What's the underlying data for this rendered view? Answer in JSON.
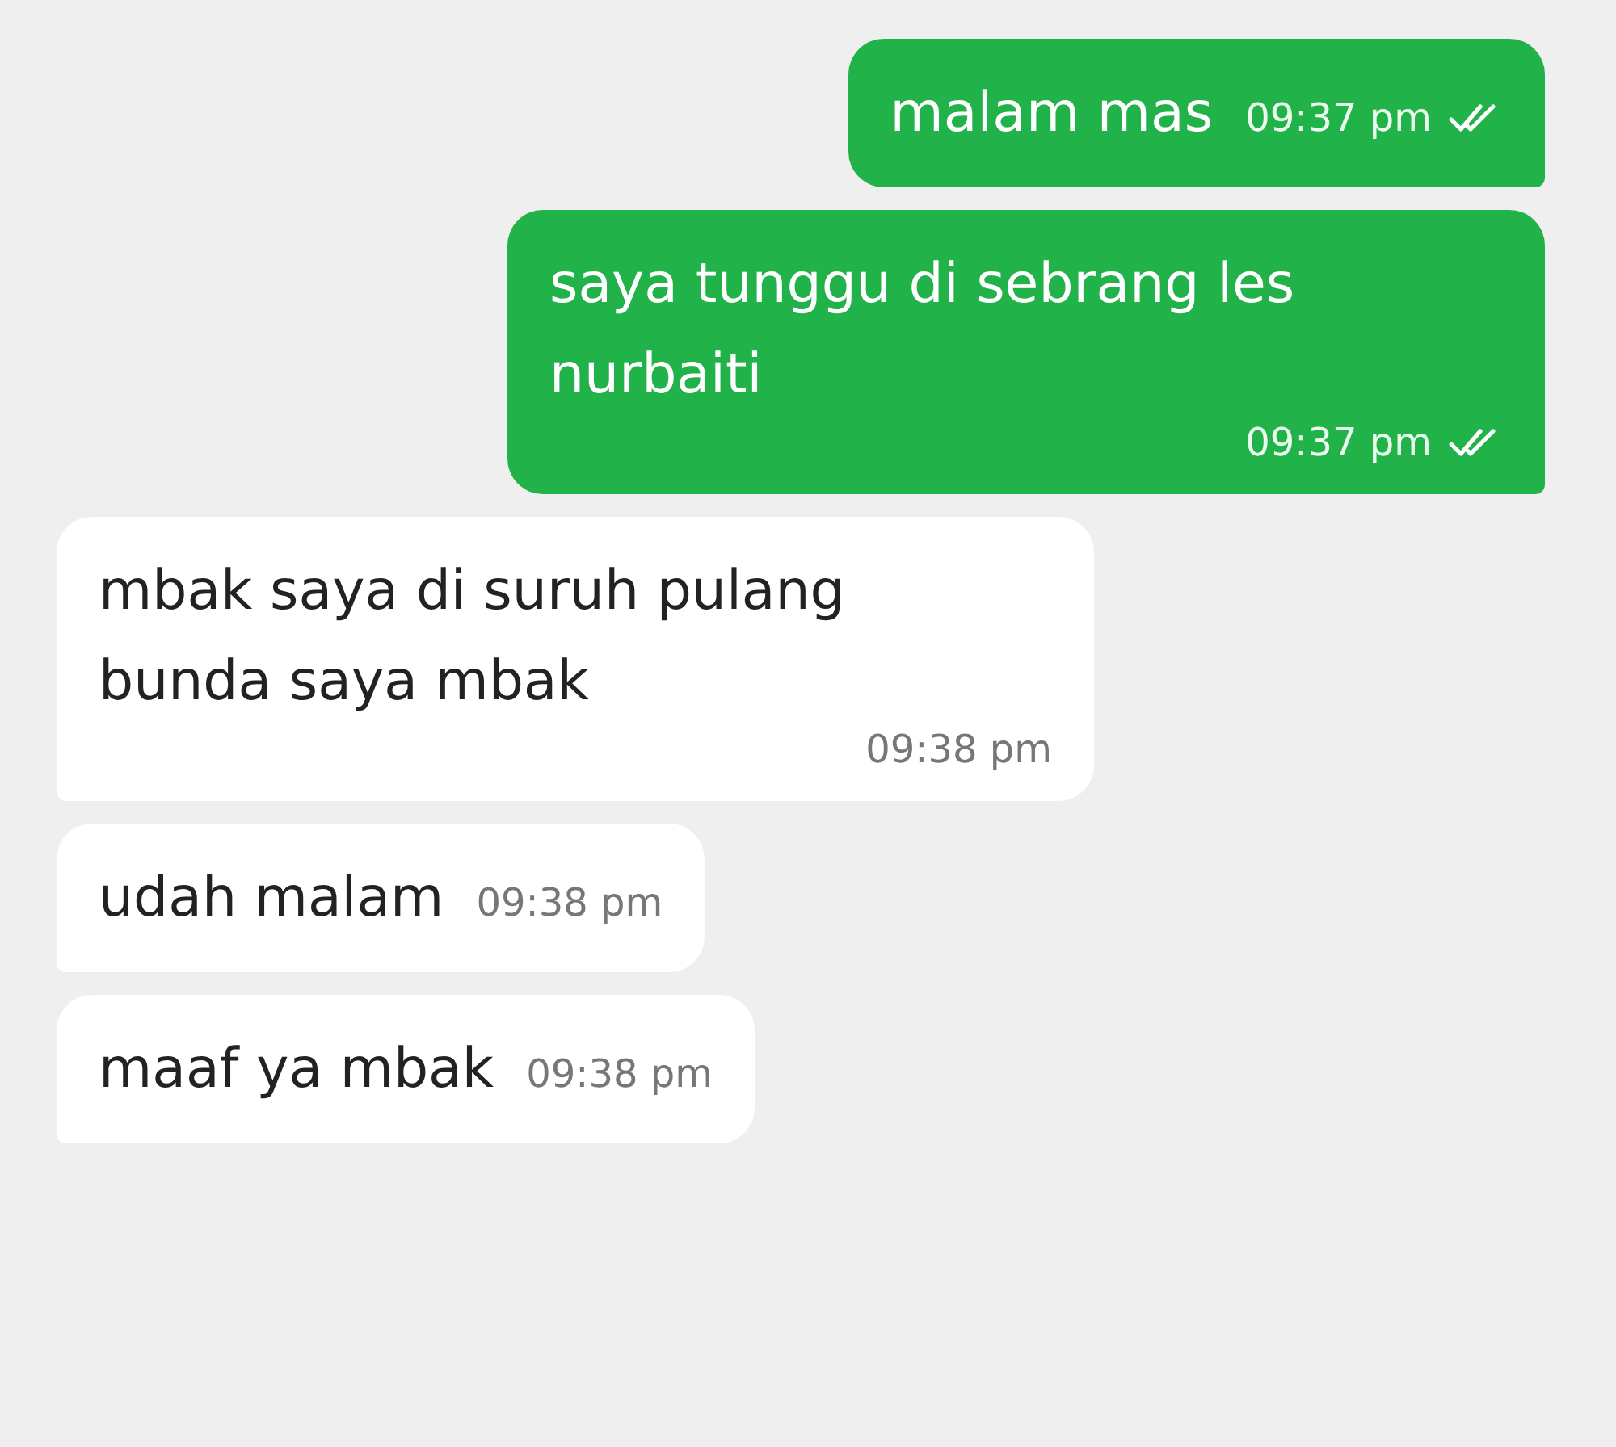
{
  "messages": [
    {
      "outgoing": true,
      "text": "malam mas",
      "time": "09:37 pm",
      "read": true
    },
    {
      "outgoing": true,
      "text": "saya tunggu di sebrang les nurbaiti",
      "time": "09:37 pm",
      "read": true
    },
    {
      "outgoing": false,
      "text": "mbak saya di suruh pulang bunda saya mbak",
      "time": "09:38 pm"
    },
    {
      "outgoing": false,
      "text": "udah malam",
      "time": "09:38 pm"
    },
    {
      "outgoing": false,
      "text": "maaf ya mbak",
      "time": "09:38 pm"
    }
  ]
}
